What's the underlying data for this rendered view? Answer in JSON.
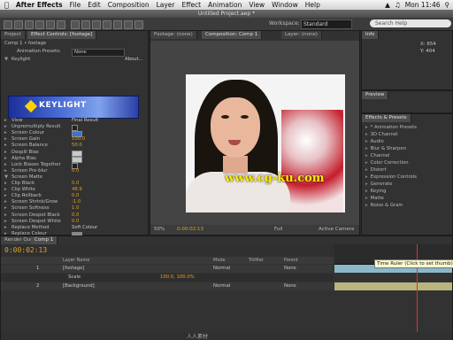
{
  "menubar": {
    "app_name": "After Effects",
    "items": [
      "File",
      "Edit",
      "Composition",
      "Layer",
      "Effect",
      "Animation",
      "View",
      "Window",
      "Help"
    ],
    "clock": "Mon 11:46"
  },
  "window_title": "Untitled Project.aep *",
  "toolbar": {
    "workspace_label": "Workspace:",
    "workspace_value": "Standard",
    "search_placeholder": "Search Help"
  },
  "effect_controls": {
    "tab_project": "Project",
    "tab_effect_controls": "Effect Controls: [footage]",
    "layer_label": "Comp 1 • footage",
    "animation_presets_label": "Animation Presets:",
    "animation_presets_value": "None",
    "effect_name": "Keylight",
    "about_label": "About...",
    "banner_text": "KEYLIGHT",
    "rows": [
      {
        "name": "View",
        "value": "Final Result",
        "kind": "text"
      },
      {
        "name": "Unpremultiply Result",
        "value": "",
        "kind": "check"
      },
      {
        "name": "Screen Colour",
        "value": "",
        "kind": "swatch",
        "color": "#3a74d6"
      },
      {
        "name": "Screen Gain",
        "value": "100.0",
        "kind": "num"
      },
      {
        "name": "Screen Balance",
        "value": "50.0",
        "kind": "num"
      },
      {
        "name": "Despill Bias",
        "value": "",
        "kind": "swatch",
        "color": "#c9c9c9"
      },
      {
        "name": "Alpha Bias",
        "value": "",
        "kind": "swatch",
        "color": "#c9c9c9"
      },
      {
        "name": "Lock Biases Together",
        "value": "",
        "kind": "check"
      },
      {
        "name": "Screen Pre-blur",
        "value": "0.0",
        "kind": "num"
      },
      {
        "name": "Screen Matte",
        "value": "",
        "kind": "group"
      },
      {
        "name": "Clip Black",
        "value": "0.0",
        "kind": "num"
      },
      {
        "name": "Clip White",
        "value": "48.9",
        "kind": "num"
      },
      {
        "name": "Clip Rollback",
        "value": "0.0",
        "kind": "num"
      },
      {
        "name": "Screen Shrink/Grow",
        "value": "-1.0",
        "kind": "num"
      },
      {
        "name": "Screen Softness",
        "value": "1.0",
        "kind": "num"
      },
      {
        "name": "Screen Despot Black",
        "value": "0.0",
        "kind": "num"
      },
      {
        "name": "Screen Despot White",
        "value": "0.0",
        "kind": "num"
      },
      {
        "name": "Replace Method",
        "value": "Soft Colour",
        "kind": "text"
      },
      {
        "name": "Replace Colour",
        "value": "",
        "kind": "swatch",
        "color": "#8a8a8a"
      }
    ]
  },
  "composition": {
    "tab_footage": "Footage: (none)",
    "tab_comp": "Composition: Comp 1",
    "tab_layer": "Layer: (none)",
    "watermark": "www.cg-ku.com",
    "zoom": "50%",
    "resolution": "Full",
    "camera": "Active Camera",
    "timecode": "0:00:02:13"
  },
  "info_panel": {
    "tab": "Info",
    "x_label": "X: 654",
    "y_label": "Y: 404"
  },
  "preview_panel": {
    "tab": "Preview"
  },
  "effects_presets": {
    "tab": "Effects & Presets",
    "items": [
      "* Animation Presets",
      "3D Channel",
      "Audio",
      "Blur & Sharpen",
      "Channel",
      "Color Correction",
      "Distort",
      "Expression Controls",
      "Generate",
      "Keying",
      "Matte",
      "Noise & Grain"
    ]
  },
  "timeline": {
    "tab_render": "Render Queue",
    "tab_comp": "Comp 1",
    "timecode": "0:00:02:13",
    "col_source": "Layer Name",
    "col_mode": "Mode",
    "col_trkmat": "TrkMat",
    "col_parent": "Parent",
    "rows": [
      {
        "num": "1",
        "name": "[footage]",
        "mode": "Normal",
        "parent": "None"
      },
      {
        "num": "",
        "name": "Scale",
        "value": "100.0, 100.0%",
        "parent": ""
      },
      {
        "num": "2",
        "name": "[Background]",
        "mode": "Normal",
        "parent": "None"
      }
    ],
    "tooltip": "Time Ruler (Click to set thumb)"
  },
  "bottom_watermark": "人人素材"
}
